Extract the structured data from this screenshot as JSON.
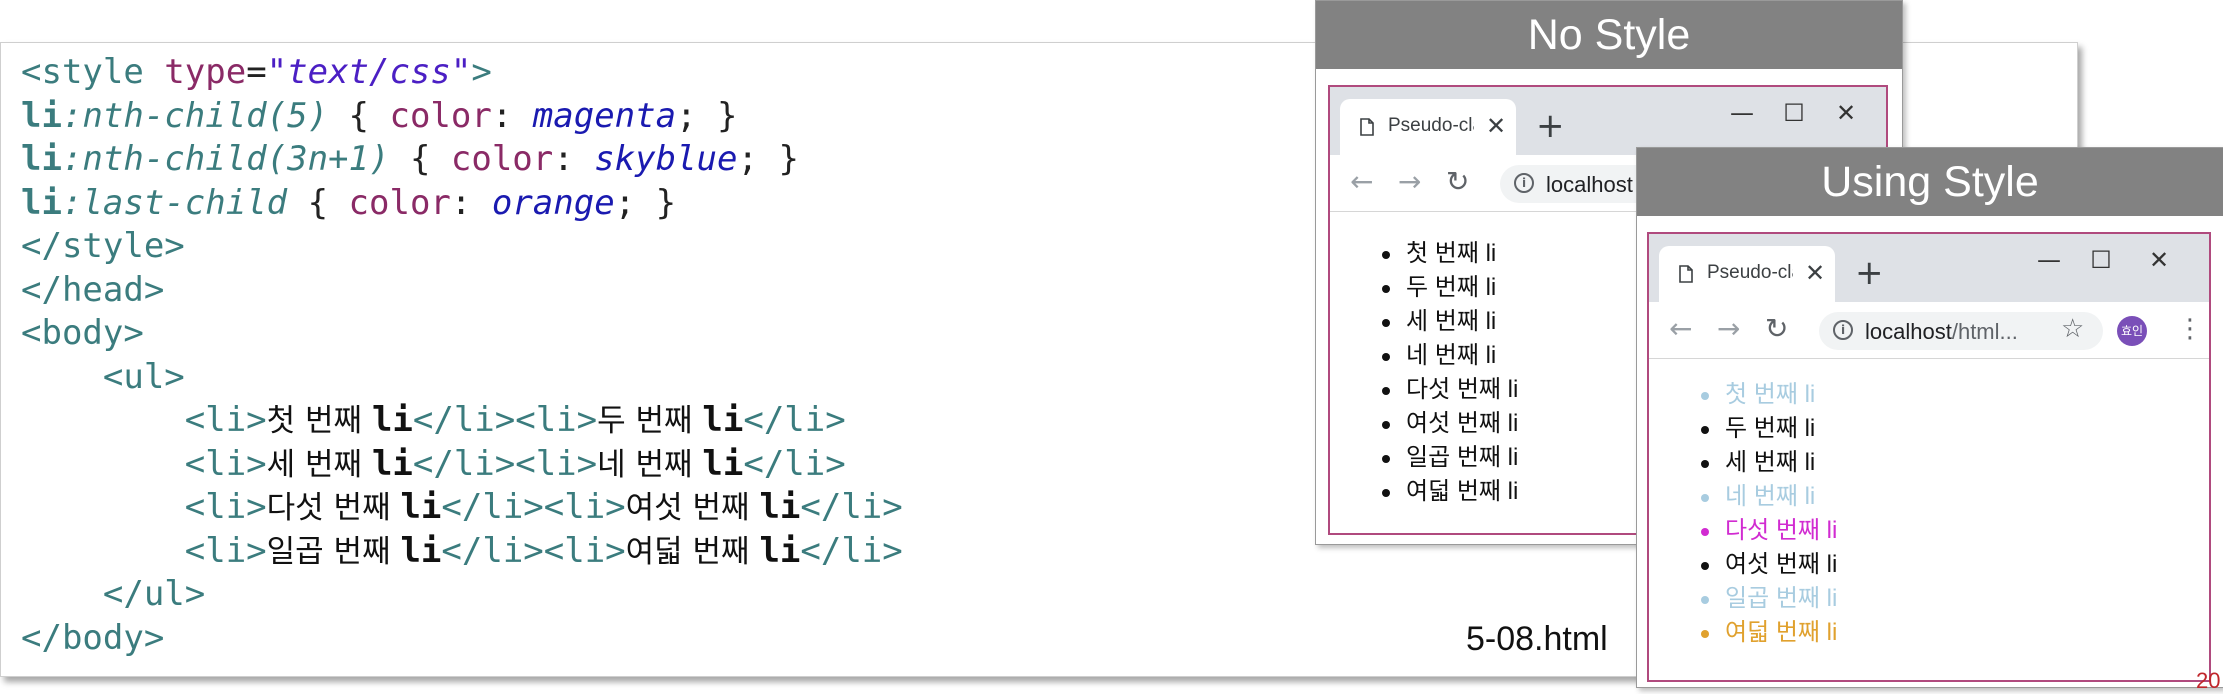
{
  "code_lines": [
    [
      [
        "tag",
        "<style "
      ],
      [
        "attr",
        "type"
      ],
      [
        "punc",
        "="
      ],
      [
        "str",
        "\"text/css\""
      ],
      [
        "tag",
        ">"
      ]
    ],
    [
      [
        "sel",
        "li"
      ],
      [
        "pseudo",
        ":nth-child(5)"
      ],
      [
        "punc",
        " { "
      ],
      [
        "prop",
        "color"
      ],
      [
        "punc",
        ": "
      ],
      [
        "val",
        "magenta"
      ],
      [
        "punc",
        "; }"
      ]
    ],
    [
      [
        "sel",
        "li"
      ],
      [
        "pseudo",
        ":nth-child(3n+1)"
      ],
      [
        "punc",
        " { "
      ],
      [
        "prop",
        "color"
      ],
      [
        "punc",
        ": "
      ],
      [
        "val",
        "skyblue"
      ],
      [
        "punc",
        "; }"
      ]
    ],
    [
      [
        "sel",
        "li"
      ],
      [
        "pseudo",
        ":last-child"
      ],
      [
        "punc",
        " { "
      ],
      [
        "prop",
        "color"
      ],
      [
        "punc",
        ": "
      ],
      [
        "val",
        "orange"
      ],
      [
        "punc",
        "; }"
      ]
    ],
    [
      [
        "tag",
        "</style>"
      ]
    ],
    [
      [
        "tag",
        "</head>"
      ]
    ],
    [
      [
        "tag",
        "<body>"
      ]
    ],
    [
      [
        "punc",
        "    "
      ],
      [
        "tag",
        "<ul>"
      ]
    ],
    [
      [
        "punc",
        "        "
      ],
      [
        "tag",
        "<li>"
      ],
      [
        "kr",
        "첫 번째 "
      ],
      [
        "kli",
        "li"
      ],
      [
        "tag",
        "</li><li>"
      ],
      [
        "kr",
        "두 번째 "
      ],
      [
        "kli",
        "li"
      ],
      [
        "tag",
        "</li>"
      ]
    ],
    [
      [
        "punc",
        "        "
      ],
      [
        "tag",
        "<li>"
      ],
      [
        "kr",
        "세 번째 "
      ],
      [
        "kli",
        "li"
      ],
      [
        "tag",
        "</li><li>"
      ],
      [
        "kr",
        "네 번째 "
      ],
      [
        "kli",
        "li"
      ],
      [
        "tag",
        "</li>"
      ]
    ],
    [
      [
        "punc",
        "        "
      ],
      [
        "tag",
        "<li>"
      ],
      [
        "kr",
        "다섯 번째 "
      ],
      [
        "kli",
        "li"
      ],
      [
        "tag",
        "</li><li>"
      ],
      [
        "kr",
        "여섯 번째 "
      ],
      [
        "kli",
        "li"
      ],
      [
        "tag",
        "</li>"
      ]
    ],
    [
      [
        "punc",
        "        "
      ],
      [
        "tag",
        "<li>"
      ],
      [
        "kr",
        "일곱 번째 "
      ],
      [
        "kli",
        "li"
      ],
      [
        "tag",
        "</li><li>"
      ],
      [
        "kr",
        "여덟 번째 "
      ],
      [
        "kli",
        "li"
      ],
      [
        "tag",
        "</li>"
      ]
    ],
    [
      [
        "punc",
        "    "
      ],
      [
        "tag",
        "</ul>"
      ]
    ],
    [
      [
        "tag",
        "</body>"
      ]
    ]
  ],
  "file_label": "5-08.html",
  "corner_number": "20",
  "no_style": {
    "header": "No Style",
    "tab_title": "Pseudo-class",
    "close": "✕",
    "newtab": "+",
    "url": "localhost",
    "items": [
      {
        "text": "첫 번째 li",
        "color": "#111111"
      },
      {
        "text": "두 번째 li",
        "color": "#111111"
      },
      {
        "text": "세 번째 li",
        "color": "#111111"
      },
      {
        "text": "네 번째 li",
        "color": "#111111"
      },
      {
        "text": "다섯 번째 li",
        "color": "#111111"
      },
      {
        "text": "여섯 번째 li",
        "color": "#111111"
      },
      {
        "text": "일곱 번째 li",
        "color": "#111111"
      },
      {
        "text": "여덟 번째 li",
        "color": "#111111"
      }
    ]
  },
  "using_style": {
    "header": "Using Style",
    "tab_title": "Pseudo-class",
    "close": "✕",
    "newtab": "+",
    "url_host": "localhost",
    "url_rest": "/html...",
    "avatar": "효인",
    "items": [
      {
        "text": "첫 번째 li",
        "color": "#a8cce0"
      },
      {
        "text": "두 번째 li",
        "color": "#111111"
      },
      {
        "text": "세 번째 li",
        "color": "#111111"
      },
      {
        "text": "네 번째 li",
        "color": "#a8cce0"
      },
      {
        "text": "다섯 번째 li",
        "color": "#d12bd1"
      },
      {
        "text": "여섯 번째 li",
        "color": "#111111"
      },
      {
        "text": "일곱 번째 li",
        "color": "#a8cce0"
      },
      {
        "text": "여덟 번째 li",
        "color": "#e0a12e"
      }
    ]
  },
  "icons": {
    "minimize": "—",
    "maximize": "☐",
    "close_window": "✕",
    "back": "←",
    "forward": "→",
    "reload": "↻",
    "star": "☆",
    "kebab": "⋮",
    "info": "i"
  }
}
